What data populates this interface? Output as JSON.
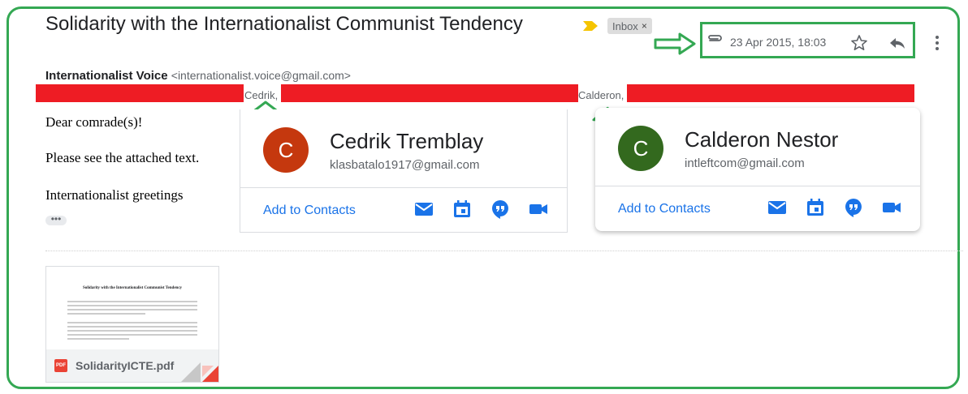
{
  "email": {
    "subject": "Solidarity with the Internationalist Communist Tendency",
    "label_chip": "Inbox",
    "label_close": "×",
    "date": "23 Apr 2015, 18:03",
    "sender_name": "Internationalist Voice",
    "sender_email": "<internationalist.voice@gmail.com>",
    "recipient_1": "Cedrik,",
    "recipient_2": "Calderon,",
    "body": {
      "line1": "Dear comrade(s)!",
      "line2": "Please see the attached text.",
      "line3": "Internationalist greetings",
      "trimmed": "•••"
    }
  },
  "contact_cards": [
    {
      "initial": "C",
      "name": "Cedrik Tremblay",
      "email": "klasbatalo1917@gmail.com",
      "action": "Add to Contacts",
      "avatar_color": "#c5380e"
    },
    {
      "initial": "C",
      "name": "Calderon Nestor",
      "email": "intleftcom@gmail.com",
      "action": "Add to Contacts",
      "avatar_color": "#33691e"
    }
  ],
  "attachment": {
    "filename": "SolidarityICTE.pdf",
    "type_badge": "PDF",
    "preview_title": "Solidarity with the Internationalist Communist Tendency"
  },
  "colors": {
    "highlight_green": "#34a853",
    "redaction_red": "#ee1c24",
    "link_blue": "#1a73e8",
    "tag_yellow": "#f5c400"
  },
  "icons": [
    "label-arrow-icon",
    "attachment-icon",
    "star-icon",
    "reply-icon",
    "more-vert-icon",
    "mail-icon",
    "calendar-icon",
    "chat-icon",
    "video-icon",
    "pdf-icon"
  ]
}
